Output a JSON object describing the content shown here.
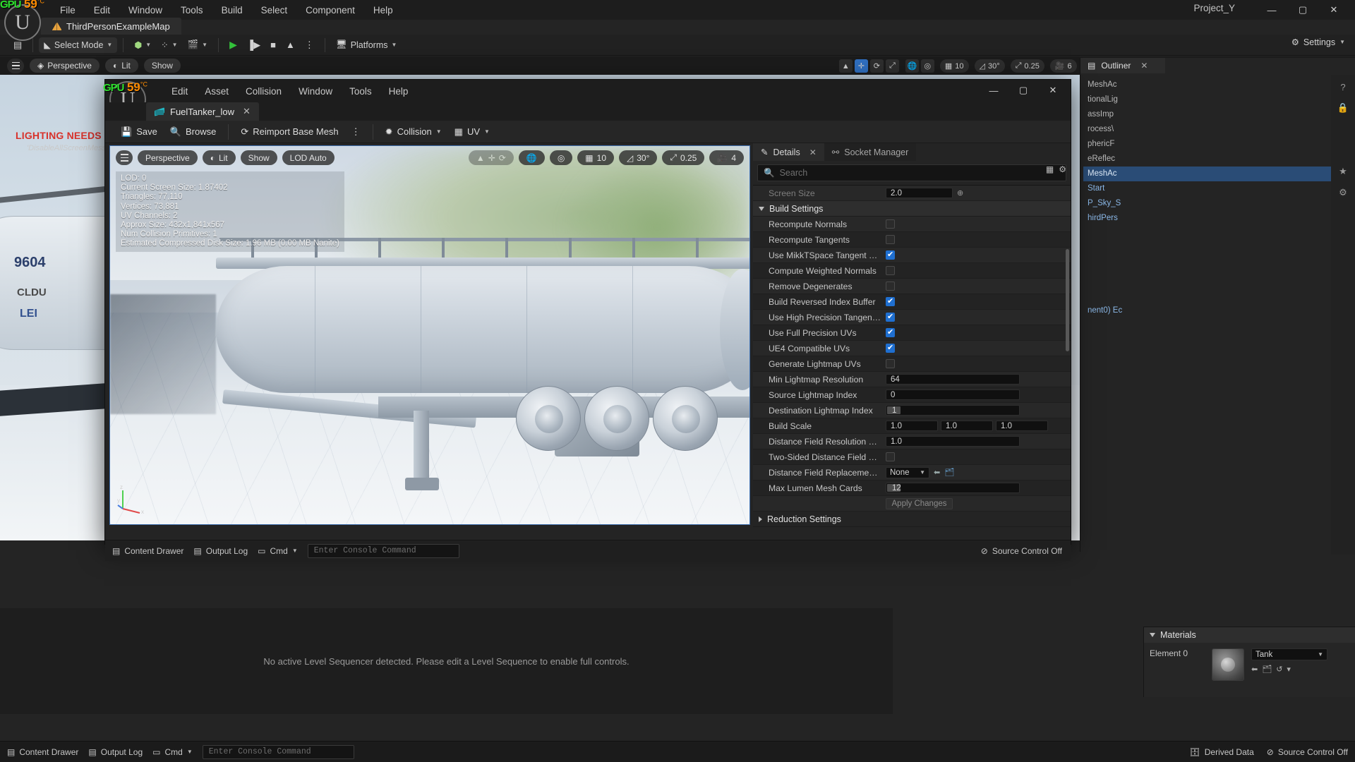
{
  "level_editor": {
    "menubar": [
      "File",
      "Edit",
      "Window",
      "Tools",
      "Build",
      "Select",
      "Component",
      "Help"
    ],
    "project_name": "Project_Y",
    "window_controls": {
      "minimize": "—",
      "maximize": "▢",
      "close": "✕"
    },
    "level_tab": {
      "label": "ThirdPersonExampleMap",
      "icon": "map-icon"
    },
    "toolbar": {
      "save_icon": "save-icon",
      "select_mode": "Select Mode",
      "add_icon": "add-actor-icon",
      "blueprint_icon": "blueprints-icon",
      "cinematics_icon": "cinematics-icon",
      "play": "▶",
      "skip": "▐▶",
      "stop": "■",
      "eject": "▲",
      "more": "⋮",
      "platforms": "Platforms",
      "settings": "Settings"
    },
    "viewport_toolbar": {
      "hamburger": "viewport-menu-icon",
      "perspective": "Perspective",
      "lit": "Lit",
      "show": "Show",
      "grid_snap": "10",
      "angle_snap": "30°",
      "scale_snap": "0.25",
      "camera_speed": "6"
    },
    "viewport_overlay": {
      "warning": "LIGHTING NEEDS TO BE REBUILT",
      "sub": "'DisableAllScreenMessages'",
      "tank_number": "9604",
      "tank_label": "LEI",
      "tank_code": "CLDU"
    },
    "outliner": {
      "title": "Outliner",
      "close": "✕",
      "items": [
        "MeshAc",
        "tionalLig",
        "assImp",
        "rocess\\",
        "phericF",
        "eReflec",
        "MeshAc",
        "Start",
        "P_Sky_S",
        "hirdPers",
        "nent0)  Ec"
      ]
    },
    "sequencer_message": "No active Level Sequencer detected. Please edit a Level Sequence to enable full controls.",
    "statusbar": {
      "content_drawer": "Content Drawer",
      "output_log": "Output Log",
      "cmd": "Cmd",
      "console_placeholder": "Enter Console Command",
      "derived_data": "Derived Data",
      "source_control": "Source Control Off"
    }
  },
  "gpu_overlay": {
    "label": "GPU",
    "value": "59",
    "unit": "°C"
  },
  "asset_editor": {
    "menubar": [
      "Edit",
      "Asset",
      "Collision",
      "Window",
      "Tools",
      "Help"
    ],
    "window_controls": {
      "minimize": "—",
      "maximize": "▢",
      "close": "✕"
    },
    "tab": {
      "label": "FuelTanker_low",
      "icon": "static-mesh-icon",
      "close": "✕"
    },
    "toolbar": {
      "save": "Save",
      "browse": "Browse",
      "reimport": "Reimport Base Mesh",
      "more": "⋮",
      "collision": "Collision",
      "uv": "UV"
    },
    "viewport": {
      "hamburger": "viewport-menu-icon",
      "perspective": "Perspective",
      "lit": "Lit",
      "show": "Show",
      "lod": "LOD Auto",
      "grid_snap": "10",
      "angle_snap": "30°",
      "scale_snap": "0.25",
      "camera_speed": "4",
      "stats": [
        "LOD: 0",
        "Current Screen Size: 1.87402",
        "Triangles:  77,110",
        "Vertices:  73,881",
        "UV Channels:  2",
        "Approx Size: 432x1,841x567",
        "Num Collision Primitives:  1",
        "Estimated Compressed Disk Size: 1.96 MB (0.00 MB Nanite)"
      ],
      "axis": {
        "x": "x",
        "y": "y",
        "z": "z"
      }
    },
    "details": {
      "tab_details": "Details",
      "tab_details_close": "✕",
      "tab_socket_manager": "Socket Manager",
      "search_placeholder": "Search",
      "screen_size_label": "Screen Size",
      "screen_size_value": "2.0",
      "section_build": "Build Settings",
      "section_reduction": "Reduction Settings",
      "rows": [
        {
          "name": "Recompute Normals",
          "type": "checkbox",
          "value": false
        },
        {
          "name": "Recompute Tangents",
          "type": "checkbox",
          "value": false
        },
        {
          "name": "Use MikkTSpace Tangent Space",
          "type": "checkbox",
          "value": true
        },
        {
          "name": "Compute Weighted Normals",
          "type": "checkbox",
          "value": false
        },
        {
          "name": "Remove Degenerates",
          "type": "checkbox",
          "value": false
        },
        {
          "name": "Build Reversed Index Buffer",
          "type": "checkbox",
          "value": true
        },
        {
          "name": "Use High Precision Tangent Basis",
          "type": "checkbox",
          "value": true
        },
        {
          "name": "Use Full Precision UVs",
          "type": "checkbox",
          "value": true
        },
        {
          "name": "UE4 Compatible UVs",
          "type": "checkbox",
          "value": true
        },
        {
          "name": "Generate Lightmap UVs",
          "type": "checkbox",
          "value": false
        },
        {
          "name": "Min Lightmap Resolution",
          "type": "number",
          "value": "64"
        },
        {
          "name": "Source Lightmap Index",
          "type": "number",
          "value": "0"
        },
        {
          "name": "Destination Lightmap Index",
          "type": "spinner",
          "value": "1"
        },
        {
          "name": "Build Scale",
          "type": "vector3",
          "value": [
            "1.0",
            "1.0",
            "1.0"
          ]
        },
        {
          "name": "Distance Field Resolution Scale",
          "type": "number",
          "value": "1.0"
        },
        {
          "name": "Two-Sided Distance Field Generation",
          "type": "checkbox",
          "value": false
        },
        {
          "name": "Distance Field Replacement Mesh",
          "type": "combo",
          "value": "None"
        },
        {
          "name": "Max Lumen Mesh Cards",
          "type": "spinner",
          "value": "12"
        }
      ],
      "apply_changes": "Apply Changes"
    },
    "bottom_bar": {
      "content_drawer": "Content Drawer",
      "output_log": "Output Log",
      "cmd": "Cmd",
      "console_placeholder": "Enter Console Command",
      "source_control": "Source Control Off"
    }
  },
  "materials_panel": {
    "title": "Materials",
    "element_label": "Element 0",
    "material_name": "Tank"
  },
  "colors": {
    "accent_blue": "#1f6fd0",
    "play_green": "#33c13a",
    "warning_red": "#d8322b",
    "gpu_green": "#2ee02e",
    "gpu_orange": "#ff8c00",
    "panel_bg": "#242424",
    "titlebar_bg": "#1d1d1d"
  }
}
